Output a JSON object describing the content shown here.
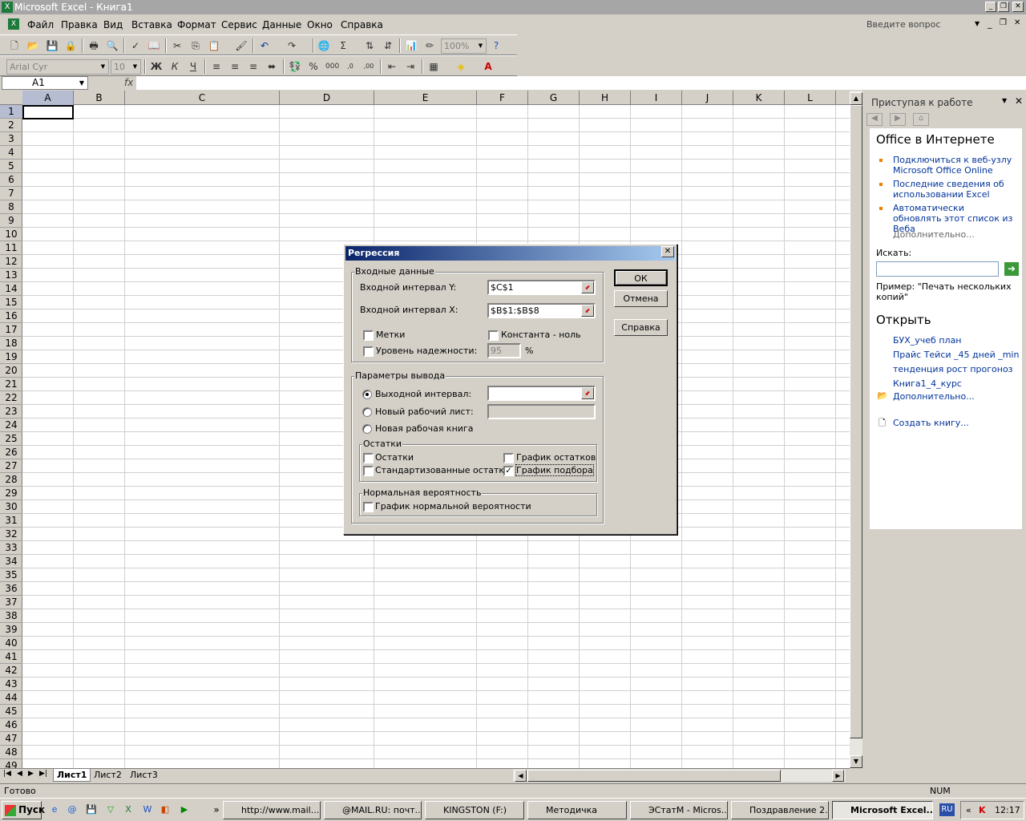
{
  "window": {
    "title": "Microsoft Excel - Книга1"
  },
  "menu": {
    "items": [
      "Файл",
      "Правка",
      "Вид",
      "Вставка",
      "Формат",
      "Сервис",
      "Данные",
      "Окно",
      "Справка"
    ],
    "question_placeholder": "Введите вопрос"
  },
  "toolbar": {
    "zoom": "100%",
    "font": "Arial Cyr",
    "size": "10",
    "bold": "Ж",
    "italic": "К",
    "underline": "Ч"
  },
  "formula": {
    "namebox": "A1",
    "fx": "fx",
    "value": ""
  },
  "grid": {
    "columns": [
      "A",
      "B",
      "C",
      "D",
      "E",
      "F",
      "G",
      "H",
      "I",
      "J",
      "K",
      "L"
    ],
    "rows": [
      "1",
      "2",
      "3",
      "4",
      "5",
      "6",
      "7",
      "8",
      "9",
      "10",
      "11",
      "12",
      "13",
      "14",
      "15",
      "16",
      "17",
      "18",
      "19",
      "20",
      "21",
      "22",
      "23",
      "24",
      "25",
      "26",
      "27",
      "28",
      "29",
      "30",
      "31",
      "32",
      "33",
      "34",
      "35",
      "36",
      "37",
      "38",
      "39",
      "40",
      "41",
      "42",
      "43",
      "44",
      "45",
      "46",
      "47",
      "48",
      "49"
    ]
  },
  "sheets": {
    "tabs": [
      "Лист1",
      "Лист2",
      "Лист3"
    ]
  },
  "status": {
    "left": "Готово",
    "num": "NUM"
  },
  "pane": {
    "title": "Приступая к работе",
    "office_heading": "Office в Интернете",
    "links": [
      "Подключиться к веб-узлу Microsoft Office Online",
      "Последние сведения об использовании Excel",
      "Автоматически обновлять этот список из Веба"
    ],
    "more": "Дополнительно...",
    "search_label": "Искать:",
    "example": "Пример:  \"Печать нескольких копий\"",
    "open_heading": "Открыть",
    "files": [
      "БУХ_учеб план",
      "Прайс Тейси _45 дней _min",
      "тенденция рост прогоноз",
      "Книга1_4_курс"
    ],
    "open_more": "Дополнительно...",
    "create": "Создать книгу..."
  },
  "dialog": {
    "title": "Регрессия",
    "input_group": "Входные данные",
    "y_label": "Входной интервал Y:",
    "y_value": "$C$1",
    "x_label": "Входной интервал X:",
    "x_value": "$B$1:$B$8",
    "labels_cb": "Метки",
    "const_cb": "Константа - ноль",
    "conf_cb": "Уровень надежности:",
    "conf_value": "95",
    "percent": "%",
    "output_group": "Параметры вывода",
    "out_range": "Выходной интервал:",
    "new_sheet": "Новый рабочий лист:",
    "new_book": "Новая рабочая книга",
    "residuals_group": "Остатки",
    "residuals": "Остатки",
    "std_residuals": "Стандартизованные остатки",
    "residual_plot": "График остатков",
    "fit_plot": "График подбора",
    "normal_group": "Нормальная вероятность",
    "normal_plot": "График нормальной вероятности",
    "ok": "ОК",
    "cancel": "Отмена",
    "help": "Справка"
  },
  "taskbar": {
    "start": "Пуск",
    "items": [
      "http://www.mail....",
      "@MAIL.RU: почт...",
      "KINGSTON (F:)",
      "Методичка",
      "ЭСтатМ - Micros...",
      "Поздравление 2...",
      "Microsoft Excel..."
    ],
    "lang": "RU",
    "clock": "12:17"
  }
}
